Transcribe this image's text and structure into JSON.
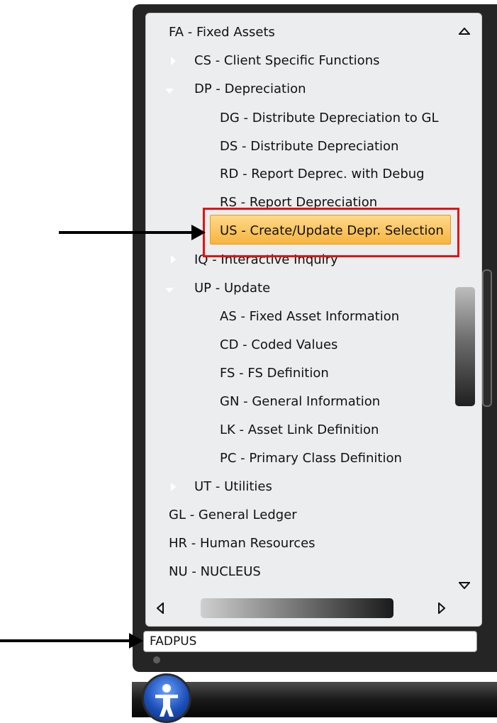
{
  "menu": {
    "root_label": "FA - Fixed Assets",
    "items": [
      {
        "label": "CS - Client Specific Functions"
      },
      {
        "label": "DP - Depreciation"
      },
      {
        "label": "DG - Distribute Depreciation to GL"
      },
      {
        "label": "DS - Distribute Depreciation"
      },
      {
        "label": "RD - Report Deprec. with Debug"
      },
      {
        "label": "RS - Report Depreciation"
      },
      {
        "label": "US - Create/Update Depr. Selection"
      },
      {
        "label": "IQ - Interactive Inquiry"
      },
      {
        "label": "UP - Update"
      },
      {
        "label": "AS - Fixed Asset Information"
      },
      {
        "label": "CD - Coded Values"
      },
      {
        "label": "FS - FS Definition"
      },
      {
        "label": "GN - General Information"
      },
      {
        "label": "LK - Asset Link Definition"
      },
      {
        "label": "PC - Primary Class Definition"
      },
      {
        "label": "UT - Utilities"
      },
      {
        "label": "GL - General Ledger"
      },
      {
        "label": "HR - Human Resources"
      },
      {
        "label": "NU - NUCLEUS"
      }
    ]
  },
  "status_bar": {
    "value": "FADPUS"
  },
  "icons": {
    "scroll_up": "triangle-up-icon",
    "scroll_down": "triangle-down-icon",
    "scroll_left": "triangle-left-icon",
    "scroll_right": "triangle-right-icon",
    "start": "accessibility-icon"
  },
  "colors": {
    "selection": "#f7b43f",
    "highlight_box": "#e81010",
    "panel": "#252525"
  }
}
